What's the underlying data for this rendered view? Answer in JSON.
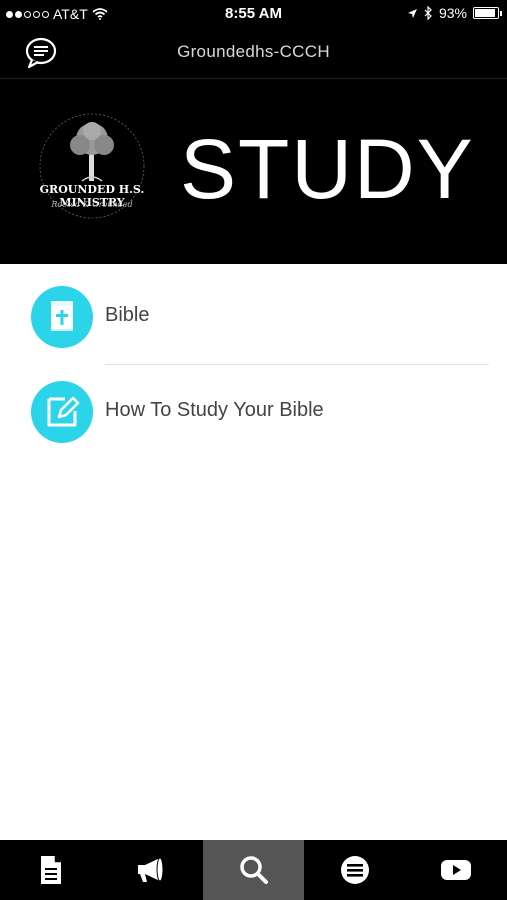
{
  "status_bar": {
    "carrier": "AT&T",
    "time": "8:55 AM",
    "battery": "93%",
    "battery_level": 0.93,
    "icons": [
      "signal-dots-icon",
      "wifi-icon",
      "location-icon",
      "bluetooth-icon",
      "battery-icon"
    ]
  },
  "nav": {
    "title": "Groundedhs-CCCH",
    "left_icon": "chat-bubble-icon"
  },
  "hero": {
    "logo_text": "GROUNDED H.S. MINISTRY",
    "logo_subtext": "Rooted & Grounded",
    "heading": "STUDY"
  },
  "list": {
    "items": [
      {
        "label": "Bible",
        "icon": "bible-cross-icon"
      },
      {
        "label": "How To Study Your Bible",
        "icon": "edit-note-icon"
      }
    ]
  },
  "tabs": [
    {
      "icon": "document-icon"
    },
    {
      "icon": "megaphone-icon"
    },
    {
      "icon": "search-icon",
      "active": true
    },
    {
      "icon": "menu-list-icon"
    },
    {
      "icon": "youtube-icon"
    }
  ],
  "colors": {
    "accent": "#2bd4e8",
    "header_bg": "#000000",
    "active_tab": "#555555"
  }
}
